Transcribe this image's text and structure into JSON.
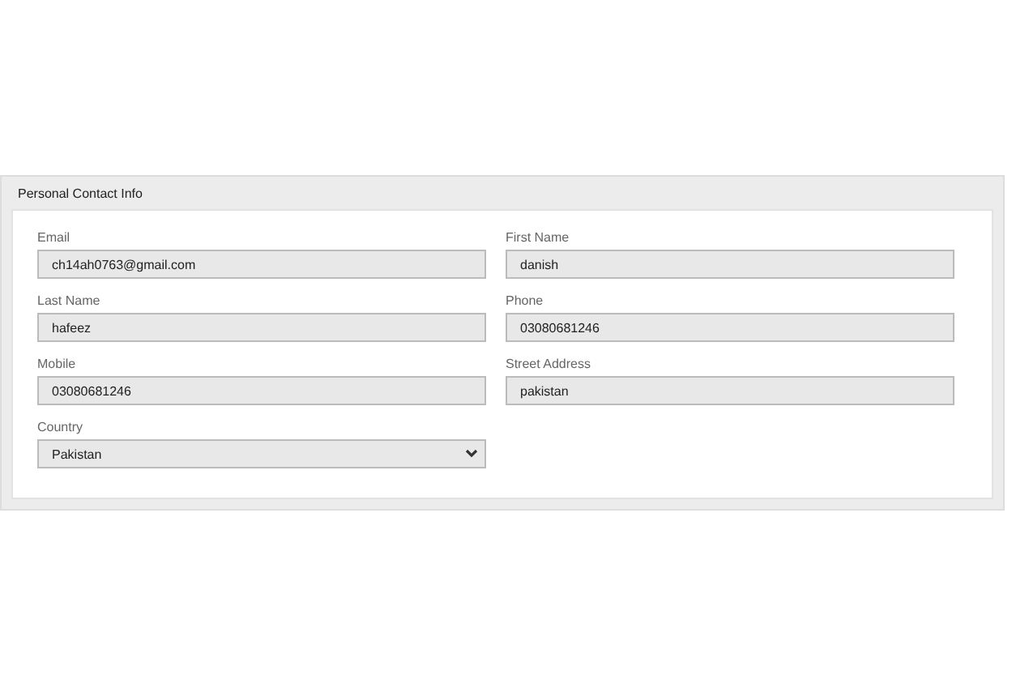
{
  "panel": {
    "title": "Personal Contact Info"
  },
  "fields": [
    {
      "label": "Email",
      "value": "ch14ah0763@gmail.com",
      "kind": "text"
    },
    {
      "label": "First Name",
      "value": "danish",
      "kind": "text"
    },
    {
      "label": "Last Name",
      "value": "hafeez",
      "kind": "text"
    },
    {
      "label": "Phone",
      "value": "03080681246",
      "kind": "text"
    },
    {
      "label": "Mobile",
      "value": "03080681246",
      "kind": "text"
    },
    {
      "label": "Street Address",
      "value": "pakistan",
      "kind": "text"
    },
    {
      "label": "Country",
      "value": "Pakistan",
      "kind": "select"
    }
  ]
}
